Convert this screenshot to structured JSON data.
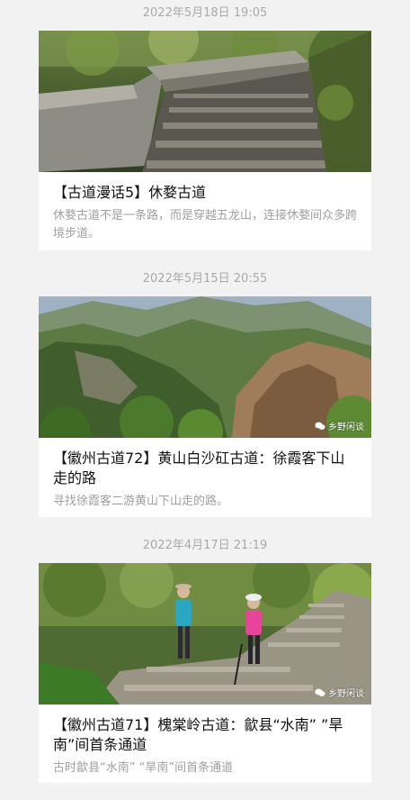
{
  "articles": [
    {
      "date": "2022年5月18日 19:05",
      "title": "【古道漫话5】休婺古道",
      "summary": "休婺古道不是一条路，而是穿越五龙山，连接休婺间众多跨境步道。",
      "watermark": ""
    },
    {
      "date": "2022年5月15日 20:55",
      "title": "【徽州古道72】黄山白沙矼古道：徐霞客下山走的路",
      "summary": "寻找徐霞客二游黄山下山走的路。",
      "watermark": "乡野闲谈"
    },
    {
      "date": "2022年4月17日 21:19",
      "title": "【徽州古道71】槐棠岭古道：歙县“水南” ”旱南”间首条通道",
      "summary": "古时歙县“水南” “旱南”间首条通道",
      "watermark": "乡野闲谈"
    }
  ]
}
